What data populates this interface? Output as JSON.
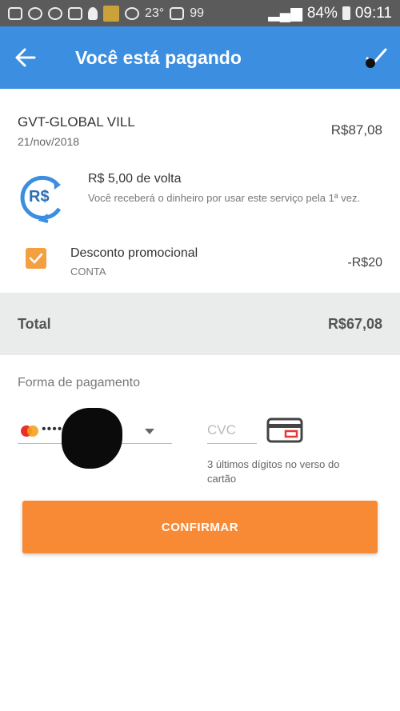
{
  "status_bar": {
    "temperature": "23°",
    "notification_count": "99",
    "battery": "84%",
    "time": "09:11"
  },
  "app_bar": {
    "title": "Você está pagando",
    "back_icon": "arrow-left-icon",
    "confirm_icon": "check-icon",
    "color": "#3b8ee0"
  },
  "merchant": {
    "name": "GVT-GLOBAL VILL",
    "date": "21/nov/2018",
    "amount": "R$87,08"
  },
  "cashback": {
    "icon": "cashback-icon",
    "icon_text": "R$",
    "title": "R$ 5,00 de volta",
    "description": "Você receberá o dinheiro por usar este serviço pela 1ª vez."
  },
  "discount": {
    "label": "Desconto promocional",
    "sublabel": "CONTA",
    "amount": "-R$20",
    "checked": true
  },
  "total": {
    "label": "Total",
    "value": "R$67,08"
  },
  "payment": {
    "title": "Forma de pagamento",
    "card_mask": "••••",
    "card_brand_icon": "mastercard-icon",
    "cvc_placeholder": "CVC",
    "cvc_hint": "3 últimos dígitos no verso do cartão"
  },
  "confirm_button": {
    "label": "CONFIRMAR",
    "color": "#f98a35"
  }
}
